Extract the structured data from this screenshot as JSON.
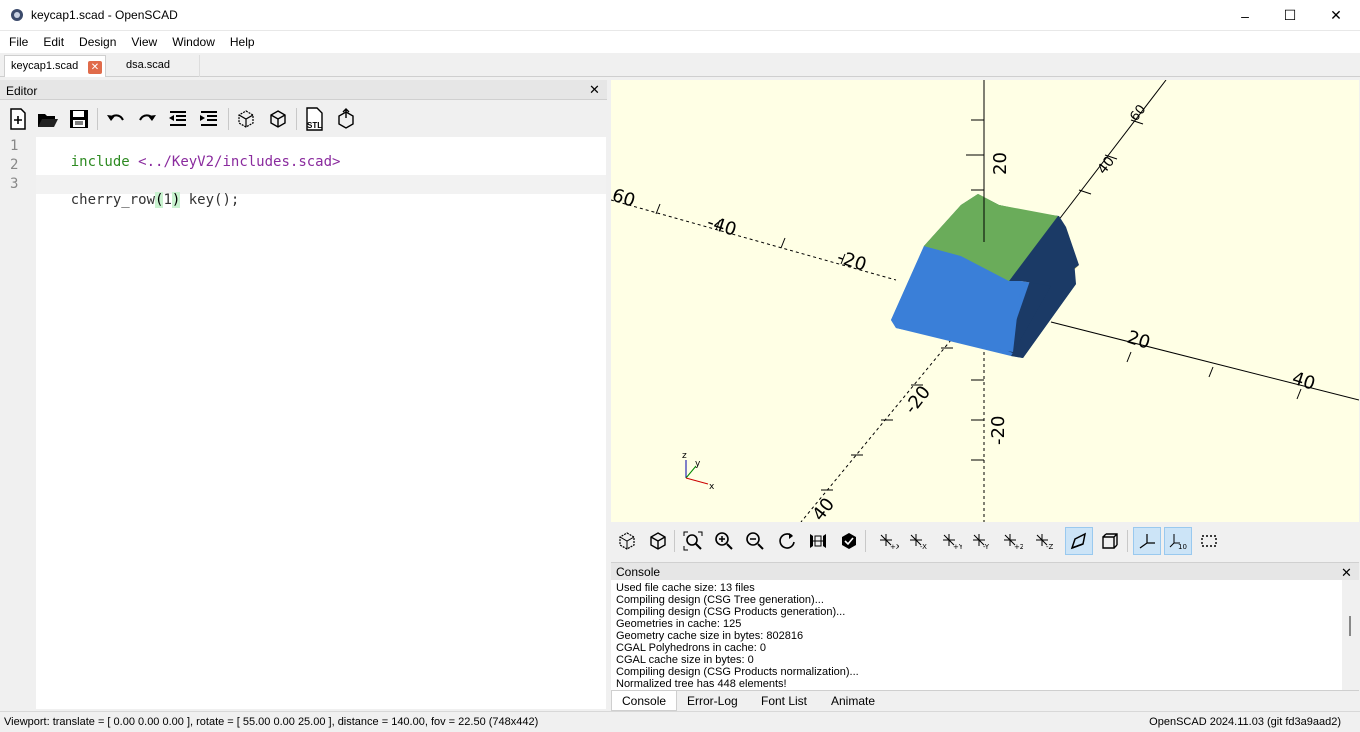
{
  "window": {
    "title": "keycap1.scad - OpenSCAD",
    "minimize": "–",
    "maximize": "☐",
    "close": "✕"
  },
  "menu": [
    "File",
    "Edit",
    "Design",
    "View",
    "Window",
    "Help"
  ],
  "tabs": [
    {
      "label": "keycap1.scad",
      "active": true
    },
    {
      "label": "dsa.scad",
      "active": false
    }
  ],
  "editor": {
    "title": "Editor",
    "toolbar": [
      "new-file-icon",
      "open-file-icon",
      "save-icon",
      "undo-icon",
      "redo-icon",
      "unindent-icon",
      "indent-icon",
      "preview-icon",
      "render-icon",
      "export-stl-icon",
      "send-to-print-icon"
    ],
    "stl_label": "STL",
    "lines": [
      {
        "n": "1",
        "parts": [
          {
            "t": "include",
            "c": "k-green"
          },
          {
            "t": " ",
            "c": "k-normal"
          },
          {
            "t": "<../KeyV2/includes.scad>",
            "c": "k-purple"
          }
        ]
      },
      {
        "n": "2",
        "parts": []
      },
      {
        "n": "3",
        "parts": [
          {
            "t": "cherry_row",
            "c": "k-normal"
          },
          {
            "t": "(",
            "c": "brk"
          },
          {
            "t": "1",
            "c": "k-normal"
          },
          {
            "t": ")",
            "c": "brk"
          },
          {
            "t": " key();",
            "c": "k-normal"
          }
        ]
      }
    ]
  },
  "viewport": {
    "axis_labels": {
      "z_pos": "20",
      "z_neg": "-20",
      "x_pos_20": "20",
      "x_pos_40": "40",
      "x_neg_20": "-20",
      "x_neg_40": "-40",
      "x_neg_60": "60",
      "y_pos_40": "40",
      "y_pos_60": "60",
      "y_neg_20": "-20",
      "y_neg_40": "40"
    },
    "keycap_colors": {
      "top": "#6aac5a",
      "front": "#3a7fd8",
      "side": "#1b3a66",
      "edge": "#e3c23a"
    },
    "axes_indicator": {
      "z": "z",
      "y": "y",
      "x": "x"
    }
  },
  "view_toolbar": [
    "preview-icon",
    "render-icon",
    "view-all-icon",
    "zoom-in-icon",
    "zoom-out-icon",
    "reset-view-icon",
    "surface-icon",
    "wireframe-icon",
    "view-right-icon",
    "view-left-icon",
    "view-top-icon",
    "view-bottom-icon",
    "view-front-icon",
    "view-back-icon",
    "perspective-icon",
    "orthogonal-icon",
    "show-axes-icon",
    "show-scale-icon",
    "show-edges-icon"
  ],
  "console": {
    "title": "Console",
    "lines": [
      "Used file cache size: 13 files",
      "Compiling design (CSG Tree generation)...",
      "Compiling design (CSG Products generation)...",
      "Geometries in cache: 125",
      "Geometry cache size in bytes: 802816",
      "CGAL Polyhedrons in cache: 0",
      "CGAL cache size in bytes: 0",
      "Compiling design (CSG Products normalization)...",
      "Normalized tree has 448 elements!"
    ],
    "tabs": [
      "Console",
      "Error-Log",
      "Font List",
      "Animate"
    ]
  },
  "status": {
    "left": "Viewport: translate = [ 0.00 0.00 0.00 ], rotate = [ 55.00 0.00 25.00 ], distance = 140.00, fov = 22.50 (748x442)",
    "right": "OpenSCAD 2024.11.03 (git fd3a9aad2)"
  }
}
